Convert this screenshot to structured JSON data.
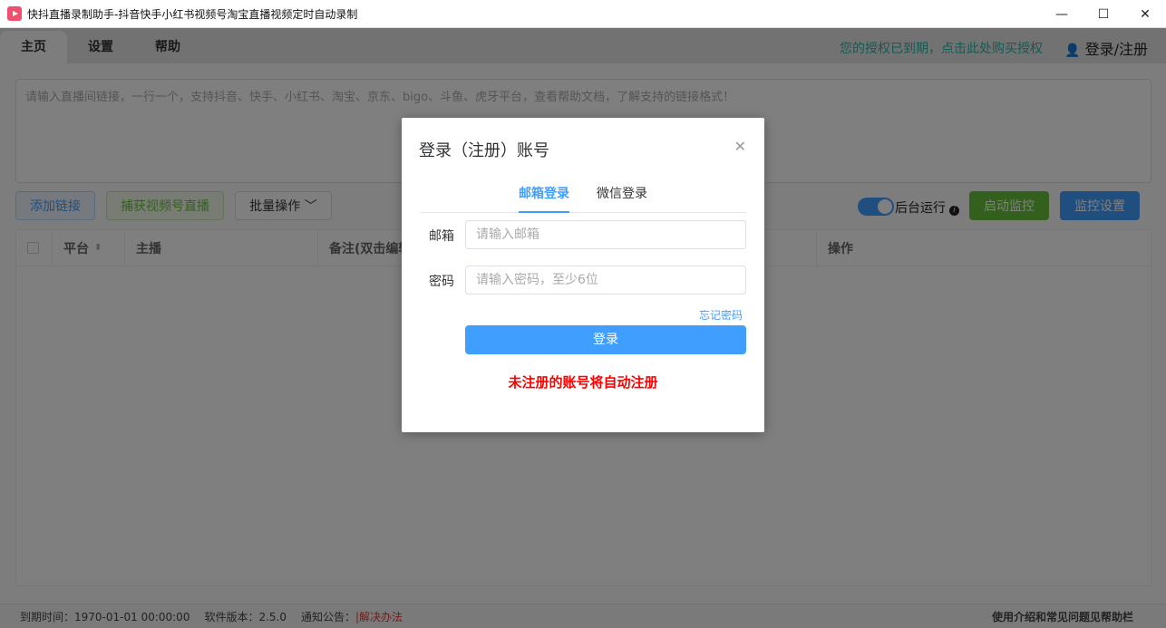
{
  "window": {
    "title": "快抖直播录制助手-抖音快手小红书视频号淘宝直播视频定时自动录制",
    "min": "—",
    "max": "☐",
    "close": "✕"
  },
  "nav": {
    "tabs": [
      "主页",
      "设置",
      "帮助"
    ],
    "notice": "您的授权已到期，点击此处购买授权",
    "login": "登录/注册"
  },
  "main": {
    "url_placeholder": "请输入直播间链接，一行一个，支持抖音、快手、小红书、淘宝、京东、bigo、斗鱼、虎牙平台，查看帮助文档，了解支持的链接格式！",
    "add_link": "添加链接",
    "capture": "捕获视频号直播",
    "batch": "批量操作 ﹀",
    "bg_run": "后台运行",
    "start": "启动监控",
    "settings": "监控设置",
    "columns": [
      "平台",
      "主播",
      "备注(双击编辑)",
      "操作"
    ]
  },
  "status": {
    "expire": "到期时间：1970-01-01 00:00:00",
    "version": "软件版本：2.5.0",
    "notice_label": "通知公告：",
    "notice_link": "|解决办法",
    "help": "使用介绍和常见问题见帮助栏"
  },
  "modal": {
    "title": "登录（注册）账号",
    "tabs": [
      "邮箱登录",
      "微信登录"
    ],
    "email_label": "邮箱",
    "email_placeholder": "请输入邮箱",
    "pwd_label": "密码",
    "pwd_placeholder": "请输入密码，至少6位",
    "forgot": "忘记密码",
    "login": "登录",
    "auto_register": "未注册的账号将自动注册"
  }
}
